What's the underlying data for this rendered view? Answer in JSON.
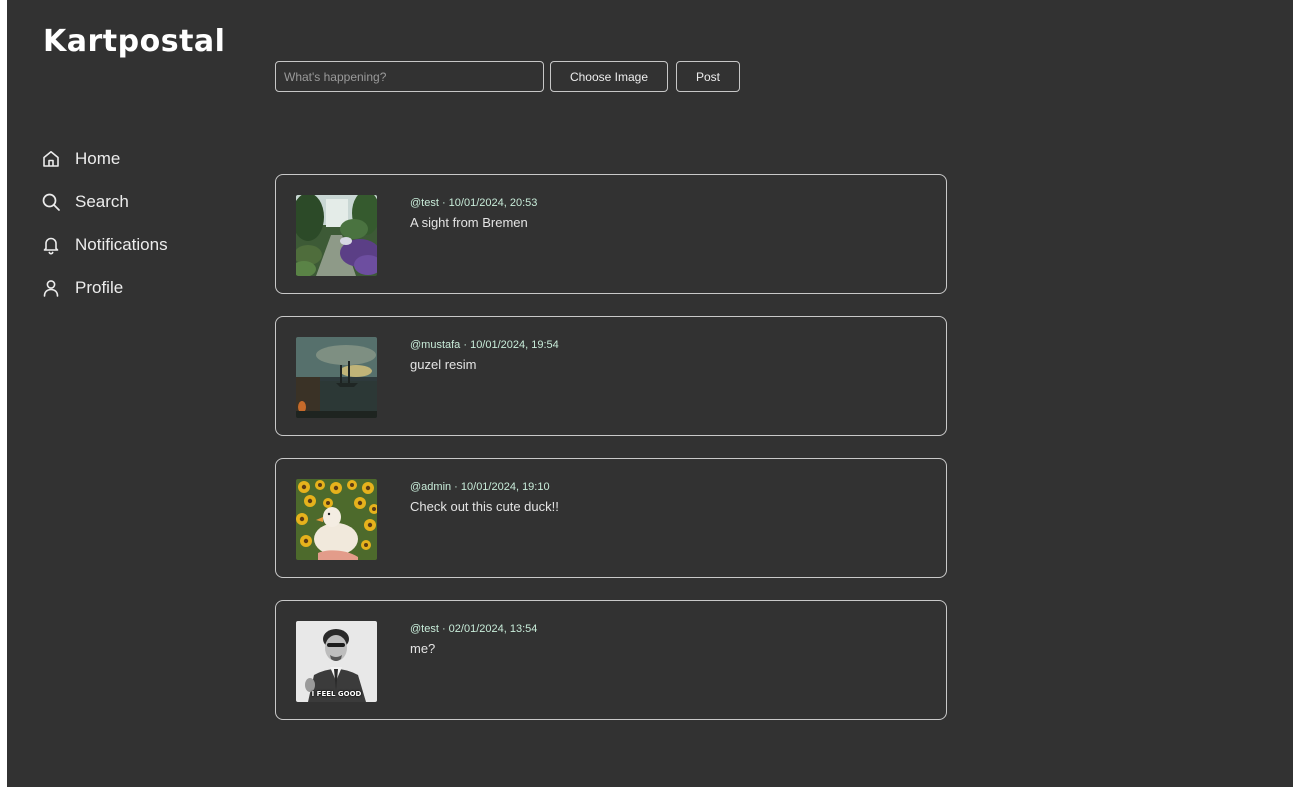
{
  "app": {
    "logo": "Kartpostal"
  },
  "nav": {
    "items": [
      {
        "label": "Home",
        "icon": "home-icon"
      },
      {
        "label": "Search",
        "icon": "search-icon"
      },
      {
        "label": "Notifications",
        "icon": "bell-icon"
      },
      {
        "label": "Profile",
        "icon": "user-icon"
      }
    ]
  },
  "composer": {
    "placeholder": "What's happening?",
    "choose_image_label": "Choose Image",
    "post_label": "Post"
  },
  "feed": {
    "posts": [
      {
        "meta": "@test · 10/01/2024, 20:53",
        "text": "A sight from Bremen",
        "image": "garden-photo"
      },
      {
        "meta": "@mustafa · 10/01/2024, 19:54",
        "text": "guzel resim",
        "image": "harbor-painting"
      },
      {
        "meta": "@admin · 10/01/2024, 19:10",
        "text": "Check out this cute duck!!",
        "image": "duck-sunflowers-photo"
      },
      {
        "meta": "@test · 02/01/2024, 13:54",
        "text": "me?",
        "image": "i-feel-good-meme",
        "image_caption": "I FEEL GOOD"
      }
    ]
  }
}
